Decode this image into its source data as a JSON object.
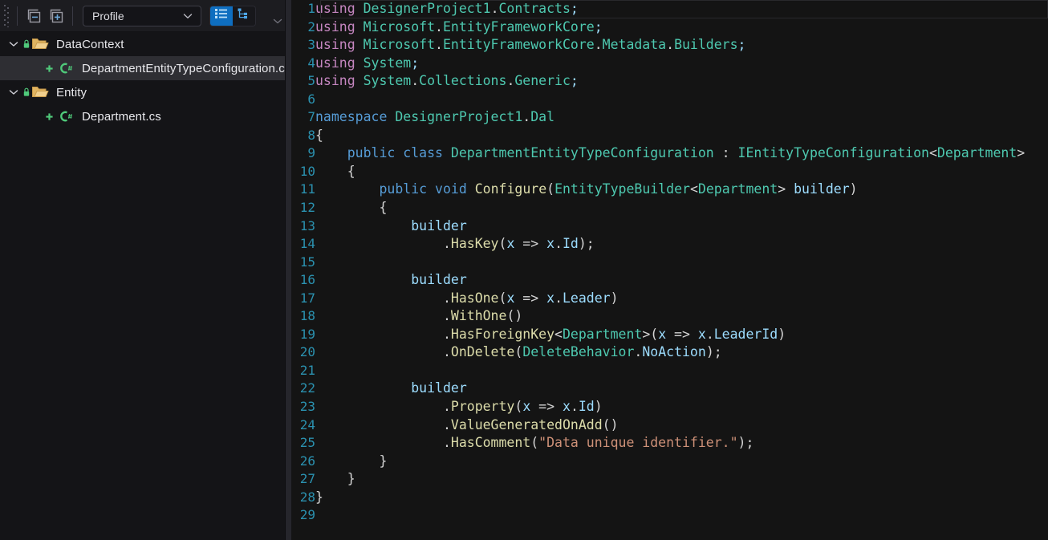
{
  "toolbar": {
    "collapse_all_label": "collapse-all",
    "expand_all_label": "expand-all",
    "profile_select": {
      "value": "Profile",
      "options": [
        "Profile"
      ]
    },
    "view_list_label": "list-view",
    "view_tree_label": "tree-view",
    "overflow_label": "more"
  },
  "tree": {
    "items": [
      {
        "label": "DataContext",
        "type": "folder",
        "expanded": true,
        "locked": true,
        "selected": false
      },
      {
        "label": "DepartmentEntityTypeConfiguration.cs",
        "type": "csharp-file",
        "added": true,
        "selected": true
      },
      {
        "label": "Entity",
        "type": "folder",
        "expanded": true,
        "locked": true,
        "selected": false
      },
      {
        "label": "Department.cs",
        "type": "csharp-file",
        "added": true,
        "selected": false
      }
    ]
  },
  "editor": {
    "current_line": 1,
    "first_line_number": 1,
    "last_line_number": 29,
    "lines": [
      {
        "n": "1",
        "tokens": [
          {
            "c": "k",
            "t": "using"
          },
          {
            "c": "p",
            "t": " "
          },
          {
            "c": "t",
            "t": "DesignerProject1"
          },
          {
            "c": "p",
            "t": "."
          },
          {
            "c": "t",
            "t": "Contracts"
          },
          {
            "c": "v",
            "t": ";"
          }
        ]
      },
      {
        "n": "2",
        "tokens": [
          {
            "c": "k",
            "t": "using"
          },
          {
            "c": "p",
            "t": " "
          },
          {
            "c": "t",
            "t": "Microsoft"
          },
          {
            "c": "p",
            "t": "."
          },
          {
            "c": "t",
            "t": "EntityFrameworkCore"
          },
          {
            "c": "v",
            "t": ";"
          }
        ]
      },
      {
        "n": "3",
        "tokens": [
          {
            "c": "k",
            "t": "using"
          },
          {
            "c": "p",
            "t": " "
          },
          {
            "c": "t",
            "t": "Microsoft"
          },
          {
            "c": "p",
            "t": "."
          },
          {
            "c": "t",
            "t": "EntityFrameworkCore"
          },
          {
            "c": "p",
            "t": "."
          },
          {
            "c": "t",
            "t": "Metadata"
          },
          {
            "c": "p",
            "t": "."
          },
          {
            "c": "t",
            "t": "Builders"
          },
          {
            "c": "v",
            "t": ";"
          }
        ]
      },
      {
        "n": "4",
        "tokens": [
          {
            "c": "k",
            "t": "using"
          },
          {
            "c": "p",
            "t": " "
          },
          {
            "c": "t",
            "t": "System"
          },
          {
            "c": "v",
            "t": ";"
          }
        ]
      },
      {
        "n": "5",
        "tokens": [
          {
            "c": "k",
            "t": "using"
          },
          {
            "c": "p",
            "t": " "
          },
          {
            "c": "t",
            "t": "System"
          },
          {
            "c": "p",
            "t": "."
          },
          {
            "c": "t",
            "t": "Collections"
          },
          {
            "c": "p",
            "t": "."
          },
          {
            "c": "t",
            "t": "Generic"
          },
          {
            "c": "v",
            "t": ";"
          }
        ]
      },
      {
        "n": "6",
        "tokens": []
      },
      {
        "n": "7",
        "tokens": [
          {
            "c": "kb",
            "t": "namespace"
          },
          {
            "c": "p",
            "t": " "
          },
          {
            "c": "t",
            "t": "DesignerProject1"
          },
          {
            "c": "p",
            "t": "."
          },
          {
            "c": "t",
            "t": "Dal"
          }
        ]
      },
      {
        "n": "8",
        "tokens": [
          {
            "c": "p",
            "t": "{"
          }
        ]
      },
      {
        "n": "9",
        "tokens": [
          {
            "c": "p",
            "t": "    "
          },
          {
            "c": "kb",
            "t": "public"
          },
          {
            "c": "p",
            "t": " "
          },
          {
            "c": "kb",
            "t": "class"
          },
          {
            "c": "p",
            "t": " "
          },
          {
            "c": "t",
            "t": "DepartmentEntityTypeConfiguration"
          },
          {
            "c": "p",
            "t": " : "
          },
          {
            "c": "t",
            "t": "IEntityTypeConfiguration"
          },
          {
            "c": "p",
            "t": "<"
          },
          {
            "c": "t",
            "t": "Department"
          },
          {
            "c": "p",
            "t": ">"
          }
        ]
      },
      {
        "n": "10",
        "tokens": [
          {
            "c": "p",
            "t": "    {"
          }
        ]
      },
      {
        "n": "11",
        "tokens": [
          {
            "c": "p",
            "t": "        "
          },
          {
            "c": "kb",
            "t": "public"
          },
          {
            "c": "p",
            "t": " "
          },
          {
            "c": "kb",
            "t": "void"
          },
          {
            "c": "p",
            "t": " "
          },
          {
            "c": "m",
            "t": "Configure"
          },
          {
            "c": "p",
            "t": "("
          },
          {
            "c": "t",
            "t": "EntityTypeBuilder"
          },
          {
            "c": "p",
            "t": "<"
          },
          {
            "c": "t",
            "t": "Department"
          },
          {
            "c": "p",
            "t": "> "
          },
          {
            "c": "v",
            "t": "builder"
          },
          {
            "c": "p",
            "t": ")"
          }
        ]
      },
      {
        "n": "12",
        "tokens": [
          {
            "c": "p",
            "t": "        {"
          }
        ]
      },
      {
        "n": "13",
        "tokens": [
          {
            "c": "p",
            "t": "            "
          },
          {
            "c": "v",
            "t": "builder"
          }
        ]
      },
      {
        "n": "14",
        "tokens": [
          {
            "c": "p",
            "t": "                ."
          },
          {
            "c": "m",
            "t": "HasKey"
          },
          {
            "c": "p",
            "t": "("
          },
          {
            "c": "v",
            "t": "x"
          },
          {
            "c": "p",
            "t": " => "
          },
          {
            "c": "v",
            "t": "x"
          },
          {
            "c": "p",
            "t": "."
          },
          {
            "c": "v",
            "t": "Id"
          },
          {
            "c": "p",
            "t": ");"
          }
        ]
      },
      {
        "n": "15",
        "tokens": []
      },
      {
        "n": "16",
        "tokens": [
          {
            "c": "p",
            "t": "            "
          },
          {
            "c": "v",
            "t": "builder"
          }
        ]
      },
      {
        "n": "17",
        "tokens": [
          {
            "c": "p",
            "t": "                ."
          },
          {
            "c": "m",
            "t": "HasOne"
          },
          {
            "c": "p",
            "t": "("
          },
          {
            "c": "v",
            "t": "x"
          },
          {
            "c": "p",
            "t": " => "
          },
          {
            "c": "v",
            "t": "x"
          },
          {
            "c": "p",
            "t": "."
          },
          {
            "c": "v",
            "t": "Leader"
          },
          {
            "c": "p",
            "t": ")"
          }
        ]
      },
      {
        "n": "18",
        "tokens": [
          {
            "c": "p",
            "t": "                ."
          },
          {
            "c": "m",
            "t": "WithOne"
          },
          {
            "c": "p",
            "t": "()"
          }
        ]
      },
      {
        "n": "19",
        "tokens": [
          {
            "c": "p",
            "t": "                ."
          },
          {
            "c": "m",
            "t": "HasForeignKey"
          },
          {
            "c": "p",
            "t": "<"
          },
          {
            "c": "t",
            "t": "Department"
          },
          {
            "c": "p",
            "t": ">("
          },
          {
            "c": "v",
            "t": "x"
          },
          {
            "c": "p",
            "t": " => "
          },
          {
            "c": "v",
            "t": "x"
          },
          {
            "c": "p",
            "t": "."
          },
          {
            "c": "v",
            "t": "LeaderId"
          },
          {
            "c": "p",
            "t": ")"
          }
        ]
      },
      {
        "n": "20",
        "tokens": [
          {
            "c": "p",
            "t": "                ."
          },
          {
            "c": "m",
            "t": "OnDelete"
          },
          {
            "c": "p",
            "t": "("
          },
          {
            "c": "t",
            "t": "DeleteBehavior"
          },
          {
            "c": "p",
            "t": "."
          },
          {
            "c": "v",
            "t": "NoAction"
          },
          {
            "c": "p",
            "t": ");"
          }
        ]
      },
      {
        "n": "21",
        "tokens": []
      },
      {
        "n": "22",
        "tokens": [
          {
            "c": "p",
            "t": "            "
          },
          {
            "c": "v",
            "t": "builder"
          }
        ]
      },
      {
        "n": "23",
        "tokens": [
          {
            "c": "p",
            "t": "                ."
          },
          {
            "c": "m",
            "t": "Property"
          },
          {
            "c": "p",
            "t": "("
          },
          {
            "c": "v",
            "t": "x"
          },
          {
            "c": "p",
            "t": " => "
          },
          {
            "c": "v",
            "t": "x"
          },
          {
            "c": "p",
            "t": "."
          },
          {
            "c": "v",
            "t": "Id"
          },
          {
            "c": "p",
            "t": ")"
          }
        ]
      },
      {
        "n": "24",
        "tokens": [
          {
            "c": "p",
            "t": "                ."
          },
          {
            "c": "m",
            "t": "ValueGeneratedOnAdd"
          },
          {
            "c": "p",
            "t": "()"
          }
        ]
      },
      {
        "n": "25",
        "tokens": [
          {
            "c": "p",
            "t": "                ."
          },
          {
            "c": "m",
            "t": "HasComment"
          },
          {
            "c": "p",
            "t": "("
          },
          {
            "c": "s",
            "t": "\"Data unique identifier.\""
          },
          {
            "c": "p",
            "t": ");"
          }
        ]
      },
      {
        "n": "26",
        "tokens": [
          {
            "c": "p",
            "t": "        }"
          }
        ]
      },
      {
        "n": "27",
        "tokens": [
          {
            "c": "p",
            "t": "    }"
          }
        ]
      },
      {
        "n": "28",
        "tokens": [
          {
            "c": "p",
            "t": "}"
          }
        ]
      },
      {
        "n": "29",
        "tokens": []
      }
    ]
  },
  "colors": {
    "editor_bg": "#141414",
    "sidebar_bg": "#141417",
    "toolbar_bg": "#1c1c20",
    "accent_blue": "#0e6ec0",
    "linenum": "#2b91af",
    "keyword_pink": "#c586c0",
    "keyword_blue": "#569cd6",
    "type_teal": "#4ec9b0",
    "variable_blue": "#9cdcfe",
    "method_yellow": "#dcdcaa",
    "string_orange": "#ce9178",
    "folder_yellow": "#dcb67a",
    "csharp_green": "#3fbf60",
    "selection_bg": "#2e2e33"
  }
}
